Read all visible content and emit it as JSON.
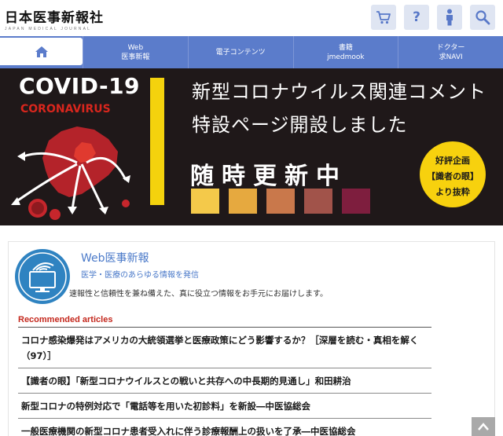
{
  "header": {
    "logo_main": "日本医事新報社",
    "logo_sub": "JAPAN MEDICAL JOURNAL",
    "icons": [
      "cart-icon",
      "help-icon",
      "person-icon",
      "search-icon"
    ],
    "help_glyph": "?"
  },
  "nav": {
    "home_icon": "home-icon",
    "items": [
      {
        "line1": "Web",
        "line2": "医事新報"
      },
      {
        "line1": "電子コンテンツ",
        "line2": ""
      },
      {
        "line1": "書籍",
        "line2": "jmedmook"
      },
      {
        "line1": "ドクター",
        "line2": "求NAVI"
      }
    ]
  },
  "banner": {
    "title": "COVID-19",
    "subtitle": "CORONAVIRUS",
    "headline_line1": "新型コロナウイルス関連コメント",
    "headline_line2": "特設ページ開設しました",
    "now_text": "随時更新中",
    "square_colors": [
      "#f4c94a",
      "#e6a93f",
      "#c9784b",
      "#a1534a",
      "#7e1e3e"
    ],
    "badge_line1": "好評企画",
    "badge_line2": "【識者の眼】",
    "badge_line3": "より抜粋",
    "colors": {
      "background": "#1f1819",
      "accent_red": "#d8261d",
      "accent_yellow": "#f4d20d"
    }
  },
  "intro": {
    "title": "Web医事新報",
    "tagline": "医学・医療のあらゆる情報を発信",
    "description": "速報性と信頼性を兼ね備えた、真に役立つ情報をお手元にお届けします。"
  },
  "recommended": {
    "label": "Recommended articles",
    "articles": [
      "コロナ感染爆発はアメリカの大統領選挙と医療政策にどう影響するか？［深層を読む・真相を解く（97）］",
      "【識者の眼】「新型コロナウイルスとの戦いと共存への中長期的見通し」和田耕治",
      "新型コロナの特例対応で「電話等を用いた初診料」を新設―中医協総会",
      "一般医療機関の新型コロナ患者受入れに伴う診療報酬上の扱いを了承―中医協総会"
    ]
  },
  "scroll_top_icon": "chevron-up-icon"
}
